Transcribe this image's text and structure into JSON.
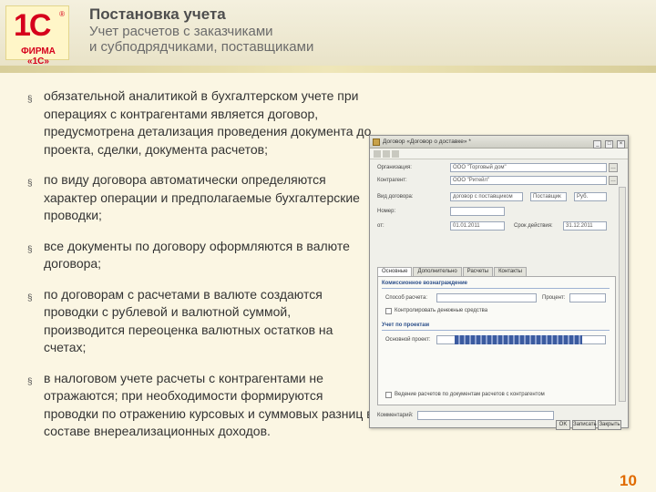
{
  "header": {
    "title": "Постановка учета",
    "subtitle_line1": "Учет расчетов с заказчиками",
    "subtitle_line2": "и субподрядчиками, поставщиками",
    "logo_text": "1С",
    "logo_reg": "®",
    "logo_firm": "ФИРМА «1С»"
  },
  "bullets": [
    "обязательной аналитикой в бухгалтерском учете при операциях с контрагентами является договор, предусмотрена детализация проведения документа до проекта, сделки, документа расчетов;",
    "по виду договора автоматически определяются характер операции и предполагаемые бухгалтерские проводки;",
    "все документы по договору оформляются в   валюте договора;",
    "по договорам с расчетами в валюте создаются проводки с рублевой и валютной суммой, производится переоценка валютных остатков на счетах;",
    "в налоговом учете расчеты с контрагентами не отражаются; при необходимости формируются проводки по отражению курсовых и суммовых разниц в составе внереализационных доходов."
  ],
  "bullet_mark": "§",
  "form": {
    "window_title": "Договор «Договор о доставке» *",
    "ctrl_min": "_",
    "ctrl_max": "□",
    "ctrl_close": "×",
    "fields": {
      "label1": "Организация:",
      "value1": "ООО \"Торговый дом\"",
      "label2": "Контрагент:",
      "value2": "ООО \"Ритейл\"",
      "label3": "Вид договора:",
      "value3": "договор с поставщиком",
      "value3b": "Поставщик",
      "value3c": "Руб.",
      "label4": "Номер:",
      "value4": "",
      "label5": "от:",
      "value5": "01.01.2011",
      "label6": "Срок действия:",
      "value6": "31.12.2011"
    },
    "tabs": [
      "Основные",
      "Дополнительно",
      "Расчеты",
      "Контакты"
    ],
    "group1_title": "Комиссионное вознаграждение",
    "group1_label": "Способ расчета:",
    "group1_label2": "Процент:",
    "group1_check": "Контролировать денежные средства",
    "group2_title": "Учет по проектам",
    "group2_label": "Основной проект:",
    "bottom_check": "Ведение расчетов по документам расчетов с контрагентом",
    "comment_label": "Комментарий:",
    "ok_label": "OK",
    "save_label": "Записать",
    "close_label": "Закрыть"
  },
  "page_number": "10"
}
